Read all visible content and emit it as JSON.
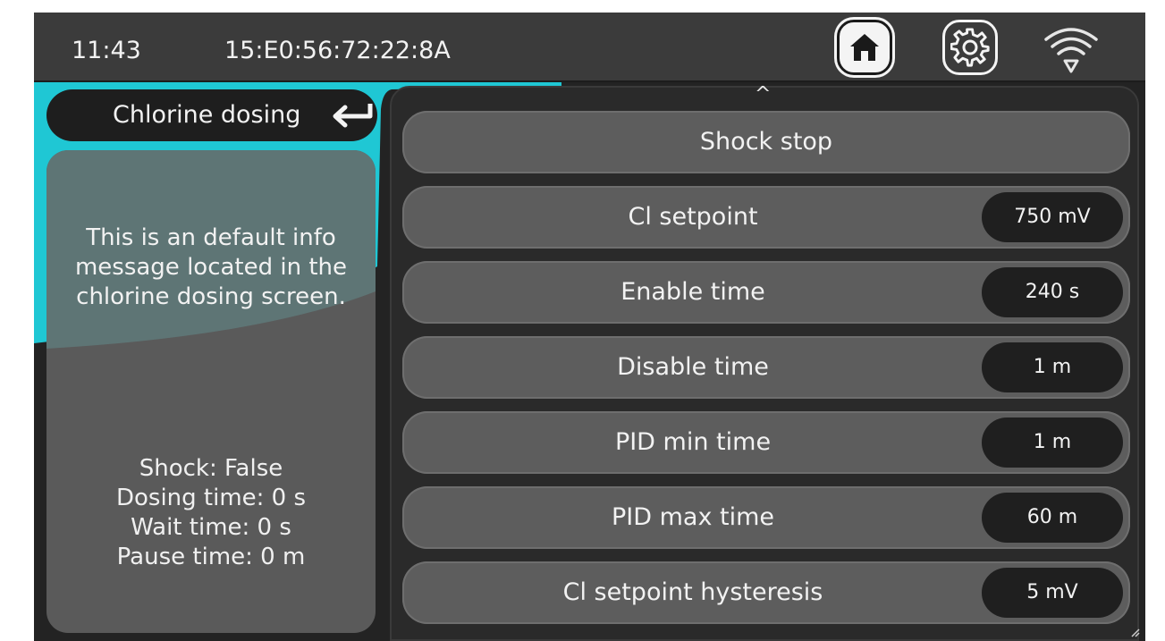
{
  "status_bar": {
    "time": "11:43",
    "device_id": "15:E0:56:72:22:8A",
    "home_icon": "home-icon",
    "settings_icon": "gear-icon",
    "wifi_icon": "wifi-icon"
  },
  "left_panel": {
    "title": "Chlorine dosing",
    "back_icon": "return-arrow-icon",
    "info_message": "This is an default info message located in the chlorine dosing screen.",
    "status": {
      "shock": "Shock: False",
      "dosing_time": "Dosing time: 0 s",
      "wait_time": "Wait time: 0 s",
      "pause_time": "Pause time: 0 m"
    }
  },
  "settings": {
    "scroll_up": "^",
    "shock_stop": "Shock stop",
    "rows": [
      {
        "label": "Cl setpoint",
        "value": "750 mV"
      },
      {
        "label": "Enable time",
        "value": "240 s"
      },
      {
        "label": "Disable time",
        "value": "1 m"
      },
      {
        "label": "PID min time",
        "value": "1 m"
      },
      {
        "label": "PID max time",
        "value": "60 m"
      },
      {
        "label": "Cl setpoint hysteresis",
        "value": "5 mV"
      }
    ]
  },
  "colors": {
    "accent": "#1fc7d4",
    "background": "#232323",
    "row": "#5d5d5d",
    "value_pill": "#1f1f1f"
  }
}
